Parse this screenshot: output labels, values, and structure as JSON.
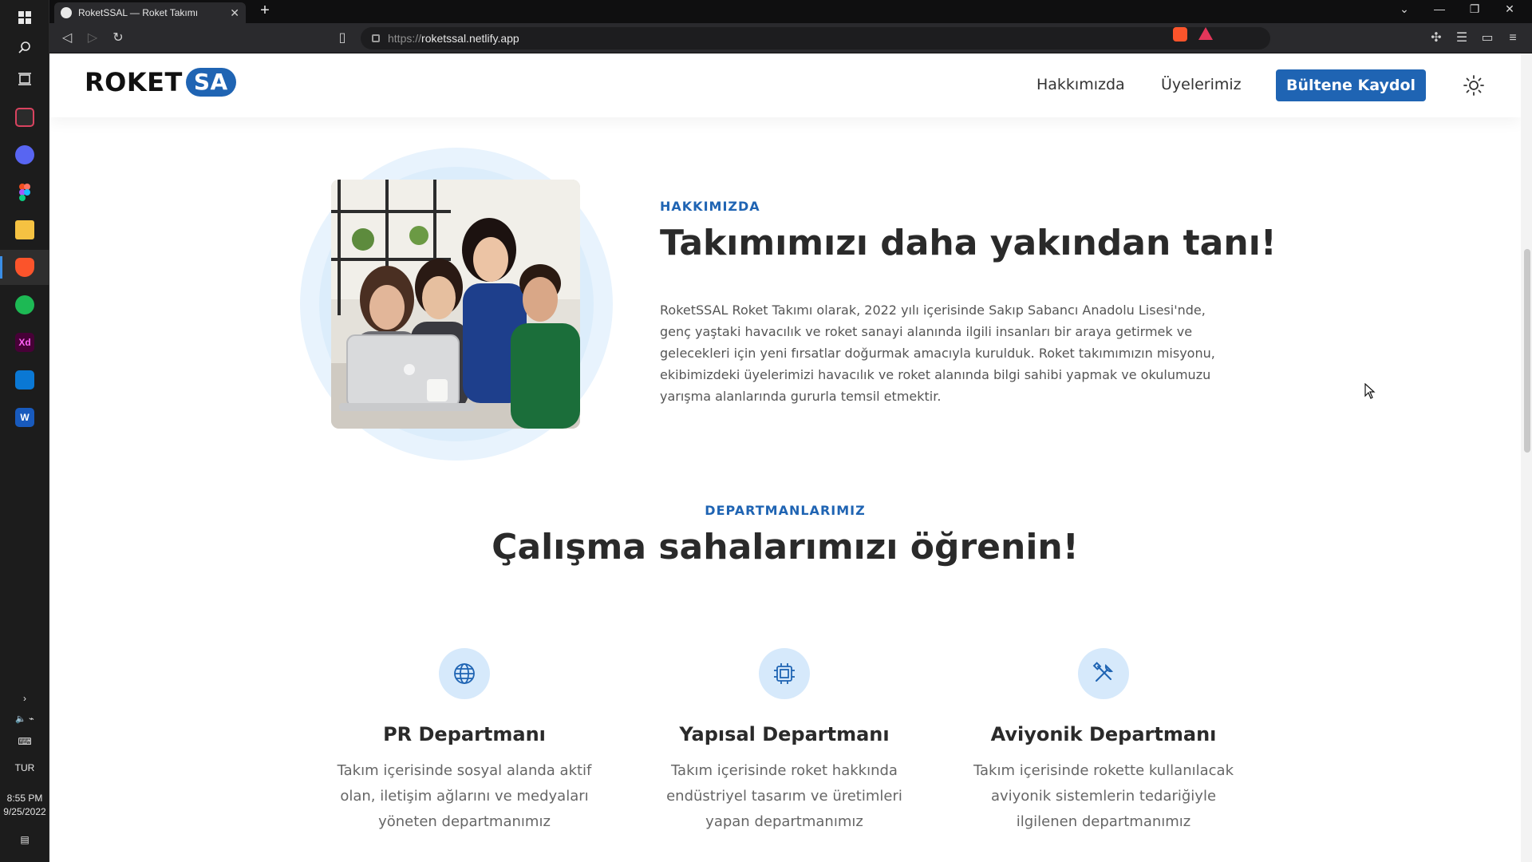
{
  "taskbar": {
    "apps": [
      {
        "name": "windows-start"
      },
      {
        "name": "search"
      },
      {
        "name": "task-view"
      },
      {
        "name": "terminal"
      },
      {
        "name": "discord"
      },
      {
        "name": "figma"
      },
      {
        "name": "file-explorer"
      },
      {
        "name": "brave-browser"
      },
      {
        "name": "spotify"
      },
      {
        "name": "adobe-xd",
        "label": "Xd"
      },
      {
        "name": "vscode"
      },
      {
        "name": "word",
        "label": "W"
      }
    ],
    "language": "TUR",
    "time": "8:55 PM",
    "date": "9/25/2022"
  },
  "browser": {
    "tab_title": "RoketSSAL — Roket Takımı",
    "url_protocol": "https://",
    "url_host": "roketssal.netlify.app"
  },
  "site": {
    "logo_main": "ROKET",
    "logo_badge": "SA",
    "nav": {
      "about": "Hakkımızda",
      "members": "Üyelerimiz",
      "subscribe": "Bültene Kaydol"
    },
    "about": {
      "kicker": "HAKKIMIZDA",
      "title": "Takımımızı daha yakından tanı!",
      "text": "RoketSSAL Roket Takımı olarak, 2022 yılı içerisinde Sakıp Sabancı Anadolu Lisesi'nde, genç yaştaki havacılık ve roket sanayi alanında ilgili insanları bir araya getirmek ve gelecekleri için yeni fırsatlar doğurmak amacıyla kurulduk. Roket takımımızın misyonu, ekibimizdeki üyelerimizi havacılık ve roket alanında bilgi sahibi yapmak ve okulumuzu yarışma alanlarında gururla temsil etmektir."
    },
    "departments": {
      "kicker": "DEPARTMANLARIMIZ",
      "title": "Çalışma sahalarımızı öğrenin!",
      "items": [
        {
          "icon": "globe-icon",
          "title": "PR Departmanı",
          "desc": "Takım içerisinde sosyal alanda aktif olan, iletişim ağlarını ve medyaları yöneten departmanımız"
        },
        {
          "icon": "chip-icon",
          "title": "Yapısal Departmanı",
          "desc": "Takım içerisinde roket hakkında endüstriyel tasarım ve üretimleri yapan departmanımız"
        },
        {
          "icon": "tools-icon",
          "title": "Aviyonik Departmanı",
          "desc": "Takım içerisinde rokette kullanılacak aviyonik sistemlerin tedariğiyle ilgilenen departmanımız"
        }
      ]
    }
  },
  "colors": {
    "accent": "#1f64b3",
    "icon_bg": "#d6e9fb"
  }
}
